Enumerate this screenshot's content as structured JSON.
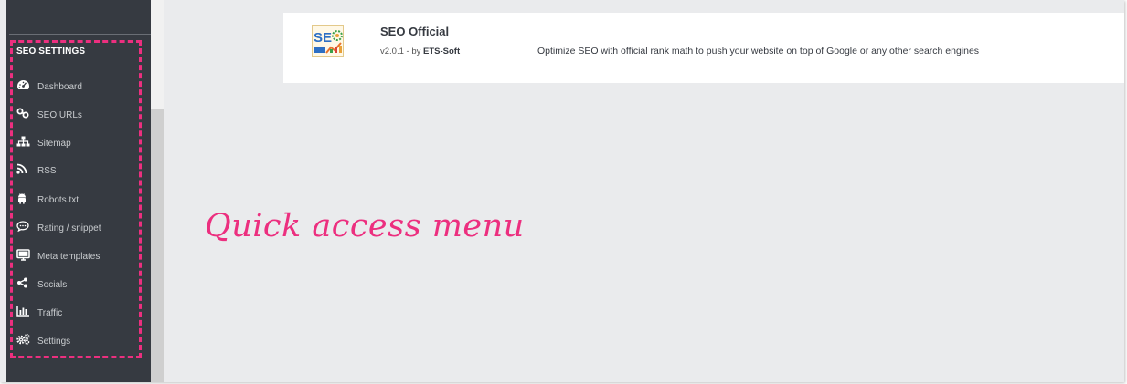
{
  "sidebar": {
    "title": "SEO SETTINGS",
    "items": [
      {
        "label": "Dashboard",
        "icon": "dashboard-icon"
      },
      {
        "label": "SEO URLs",
        "icon": "link-icon"
      },
      {
        "label": "Sitemap",
        "icon": "sitemap-icon"
      },
      {
        "label": "RSS",
        "icon": "rss-icon"
      },
      {
        "label": "Robots.txt",
        "icon": "android-icon"
      },
      {
        "label": "Rating / snippet",
        "icon": "comment-icon"
      },
      {
        "label": "Meta templates",
        "icon": "monitor-icon"
      },
      {
        "label": "Socials",
        "icon": "share-icon"
      },
      {
        "label": "Traffic",
        "icon": "bar-chart-icon"
      },
      {
        "label": "Settings",
        "icon": "gears-icon"
      }
    ]
  },
  "module": {
    "name": "SEO Official",
    "version": "v2.0.1 - by",
    "author": "ETS-Soft",
    "description": "Optimize SEO with official rank math to push your website on top of Google or any other search engines",
    "logo_text": "SE"
  },
  "annotation": {
    "text": "Quick access menu",
    "color": "#ec2f7f"
  },
  "colors": {
    "sidebar_bg": "#363a41",
    "accent": "#ec2f7f",
    "content_bg": "#eaebed"
  }
}
